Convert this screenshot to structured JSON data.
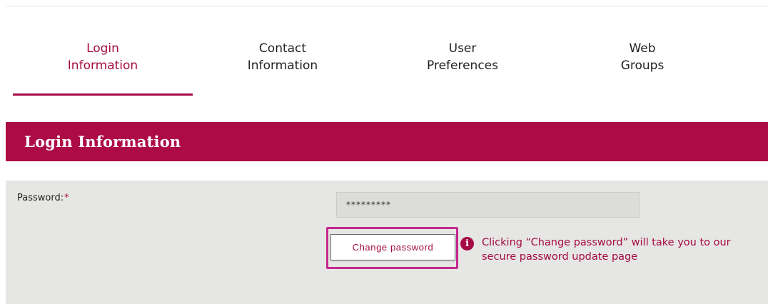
{
  "tabs": [
    {
      "line1": "Login",
      "line2": "Information",
      "active": true
    },
    {
      "line1": "Contact",
      "line2": "Information",
      "active": false
    },
    {
      "line1": "User",
      "line2": "Preferences",
      "active": false
    },
    {
      "line1": "Web",
      "line2": "Groups",
      "active": false
    }
  ],
  "section": {
    "title": "Login Information"
  },
  "form": {
    "password_label": "Password:",
    "required_marker": "*",
    "password_value": "*********",
    "change_password_label": "Change password",
    "info_icon_glyph": "i",
    "info_icon": "info-circle-icon",
    "info_text": "Clicking “Change password” will take you to our secure password update page"
  },
  "colors": {
    "accent": "#ad0b45",
    "highlight_border": "#c6288e",
    "panel_bg": "#e6e6e4"
  }
}
